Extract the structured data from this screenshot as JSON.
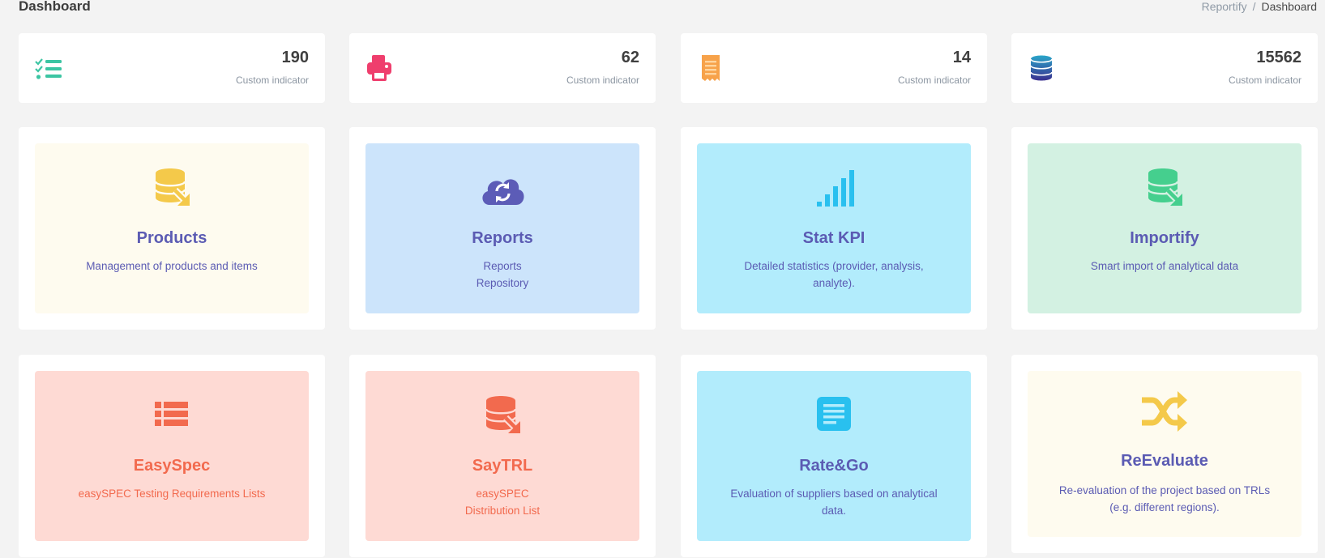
{
  "header": {
    "title": "Dashboard",
    "breadcrumb": [
      "Reportify",
      "Dashboard"
    ]
  },
  "stats": [
    {
      "icon": "checklist-icon",
      "value": "190",
      "caption": "Custom indicator",
      "color": "#3cc5a3"
    },
    {
      "icon": "printer-icon",
      "value": "62",
      "caption": "Custom indicator",
      "color": "#ef3e6d"
    },
    {
      "icon": "receipt-icon",
      "value": "14",
      "caption": "Custom indicator",
      "color": "#f7a24a"
    },
    {
      "icon": "database-icon",
      "value": "15562",
      "caption": "Custom indicator",
      "color": "#2e3f8f"
    }
  ],
  "apps": [
    {
      "icon": "database-export-icon",
      "title": "Products",
      "desc": [
        "Management of products and items"
      ],
      "bg": "#fefbef",
      "icon_color": "#f4c94a",
      "text_color": "#5b5bb3"
    },
    {
      "icon": "cloud-sync-icon",
      "title": "Reports",
      "desc": [
        "Reports",
        "Repository"
      ],
      "bg": "#cce4fb",
      "icon_color": "#5c5cb7",
      "text_color": "#5b5bb3"
    },
    {
      "icon": "signal-bars-icon",
      "title": "Stat KPI",
      "desc": [
        "Detailed statistics (provider, analysis,",
        "analyte)."
      ],
      "bg": "#b2ecfc",
      "icon_color": "#29c0ef",
      "text_color": "#5b5bb3"
    },
    {
      "icon": "database-export-icon",
      "title": "Importify",
      "desc": [
        "Smart import of analytical data"
      ],
      "bg": "#d3f1e2",
      "icon_color": "#45cf8e",
      "text_color": "#5b5bb3"
    },
    {
      "icon": "list-table-icon",
      "title": "EasySpec",
      "desc": [
        "easySPEC Testing Requirements Lists"
      ],
      "bg": "#fedad4",
      "icon_color": "#f26a4e",
      "text_color": "#f26a4e"
    },
    {
      "icon": "database-export-icon",
      "title": "SayTRL",
      "desc": [
        "easySPEC",
        "Distribution List"
      ],
      "bg": "#fedad4",
      "icon_color": "#f26a4e",
      "text_color": "#f26a4e"
    },
    {
      "icon": "document-icon",
      "title": "Rate&Go",
      "desc": [
        "Evaluation of suppliers based on analytical",
        "data."
      ],
      "bg": "#b2ecfc",
      "icon_color": "#29c0ef",
      "text_color": "#5b5bb3"
    },
    {
      "icon": "shuffle-icon",
      "title": "ReEvaluate",
      "desc": [
        "Re-evaluation of the project based on TRLs",
        "(e.g. different regions)."
      ],
      "bg": "#fefbef",
      "icon_color": "#f4c94a",
      "text_color": "#5b5bb3"
    }
  ]
}
